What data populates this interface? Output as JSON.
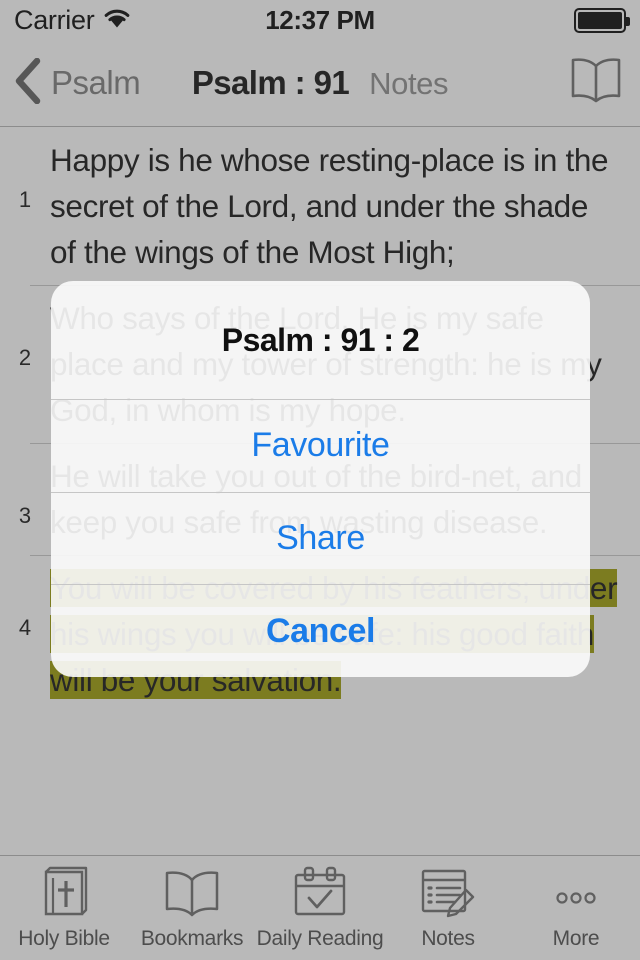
{
  "status_bar": {
    "carrier": "Carrier",
    "wifi_icon": "wifi-icon",
    "time": "12:37 PM",
    "battery_icon": "battery-full-icon"
  },
  "nav_bar": {
    "back_icon": "chevron-left-icon",
    "back_label": "Psalm",
    "title": "Psalm : 91",
    "notes_label": "Notes",
    "right_icon": "open-book-icon"
  },
  "verses": [
    {
      "number": "1",
      "text": "Happy is he whose resting-place is in the secret of the Lord, and under the shade of the wings of the Most High;",
      "highlighted": false
    },
    {
      "number": "2",
      "text": "Who says of the Lord, He is my safe place and my tower of strength: he is my God, in whom is my hope.",
      "highlighted": false
    },
    {
      "number": "3",
      "text": "He will take you out of the bird-net, and keep you safe from wasting disease.",
      "highlighted": false
    },
    {
      "number": "4",
      "text": "You will be covered by his feathers; under his wings you will be safe: his good faith will be your salvation.",
      "highlighted": true
    }
  ],
  "alert": {
    "title": "Psalm : 91 : 2",
    "buttons": [
      {
        "label": "Favourite",
        "name": "favourite-button"
      },
      {
        "label": "Share",
        "name": "share-button"
      },
      {
        "label": "Cancel",
        "name": "cancel-button"
      }
    ]
  },
  "tab_bar": {
    "items": [
      {
        "label": "Holy Bible",
        "icon": "bible-book-icon"
      },
      {
        "label": "Bookmarks",
        "icon": "open-book-icon"
      },
      {
        "label": "Daily Reading",
        "icon": "calendar-check-icon"
      },
      {
        "label": "Notes",
        "icon": "note-pencil-icon"
      },
      {
        "label": "More",
        "icon": "ellipsis-icon"
      }
    ]
  },
  "colors": {
    "highlight": "#999900",
    "accent_blue": "#1b7ce8",
    "scrim": "#505050",
    "nav_border": "#b4b4b4"
  }
}
